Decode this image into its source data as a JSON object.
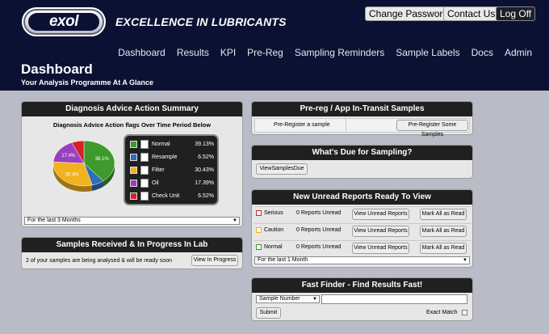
{
  "header": {
    "logo_text": "exol",
    "tagline": "EXCELLENCE IN LUBRICANTS",
    "change_password": "Change Password",
    "contact_us": "Contact Us",
    "log_off": "Log Off",
    "nav": [
      "Dashboard",
      "Results",
      "KPI",
      "Pre-Reg",
      "Sampling Reminders",
      "Sample Labels",
      "Docs",
      "Admin"
    ],
    "title": "Dashboard",
    "subtitle": "Your Analysis Programme At A Glance"
  },
  "diagnosis": {
    "heading": "Diagnosis Advice Action Summary",
    "chart_title": "Diagnosis Advice Action flags Over Time Period Below",
    "period": "For the last 3 Months"
  },
  "chart_data": {
    "type": "pie",
    "title": "Diagnosis Advice Action flags Over Time Period Below",
    "categories": [
      "Normal",
      "Resample",
      "Filter",
      "Oil",
      "Check Unit"
    ],
    "values": [
      39.13,
      6.52,
      30.43,
      17.39,
      6.52
    ],
    "labels": [
      "39.13%",
      "6.52%",
      "30.43%",
      "17.39%",
      "6.52%"
    ],
    "slice_labels": [
      "38.1%",
      "",
      "30.4%",
      "17.4%",
      ""
    ],
    "colors": [
      "#3e9a2c",
      "#2c6fb7",
      "#f2b21d",
      "#9b3fc1",
      "#d8202a"
    ],
    "legend": "right"
  },
  "samples": {
    "heading": "Samples Received & In Progress In Lab",
    "text": "2 of your samples are being analysed & will be ready soon",
    "button": "View In Progress"
  },
  "prereg": {
    "heading": "Pre-reg / App In-Transit Samples",
    "text": "Pre-Register a sample",
    "button": "Pre-Register Some Samples"
  },
  "due": {
    "heading": "What's Due for Sampling?",
    "button": "ViewSamplesDue"
  },
  "reports": {
    "heading": "New Unread Reports Ready To View",
    "rows": [
      {
        "label": "Serious",
        "count": "0 Reports Unread",
        "view": "View Unread Reports",
        "mark": "Mark All as Read",
        "color": "#d8202a"
      },
      {
        "label": "Caution",
        "count": "0 Reports Unread",
        "view": "View Unread Reports",
        "mark": "Mark All as Read",
        "color": "#f2b21d"
      },
      {
        "label": "Normal",
        "count": "0 Reports Unread",
        "view": "View Unread Reports",
        "mark": "Mark All as Read",
        "color": "#3e9a2c"
      }
    ],
    "period": "For the last 1 Month"
  },
  "finder": {
    "heading": "Fast Finder - Find Results Fast!",
    "select": "Sample Number",
    "input_value": "",
    "submit": "Submit",
    "exact_match": "Exact Match"
  }
}
